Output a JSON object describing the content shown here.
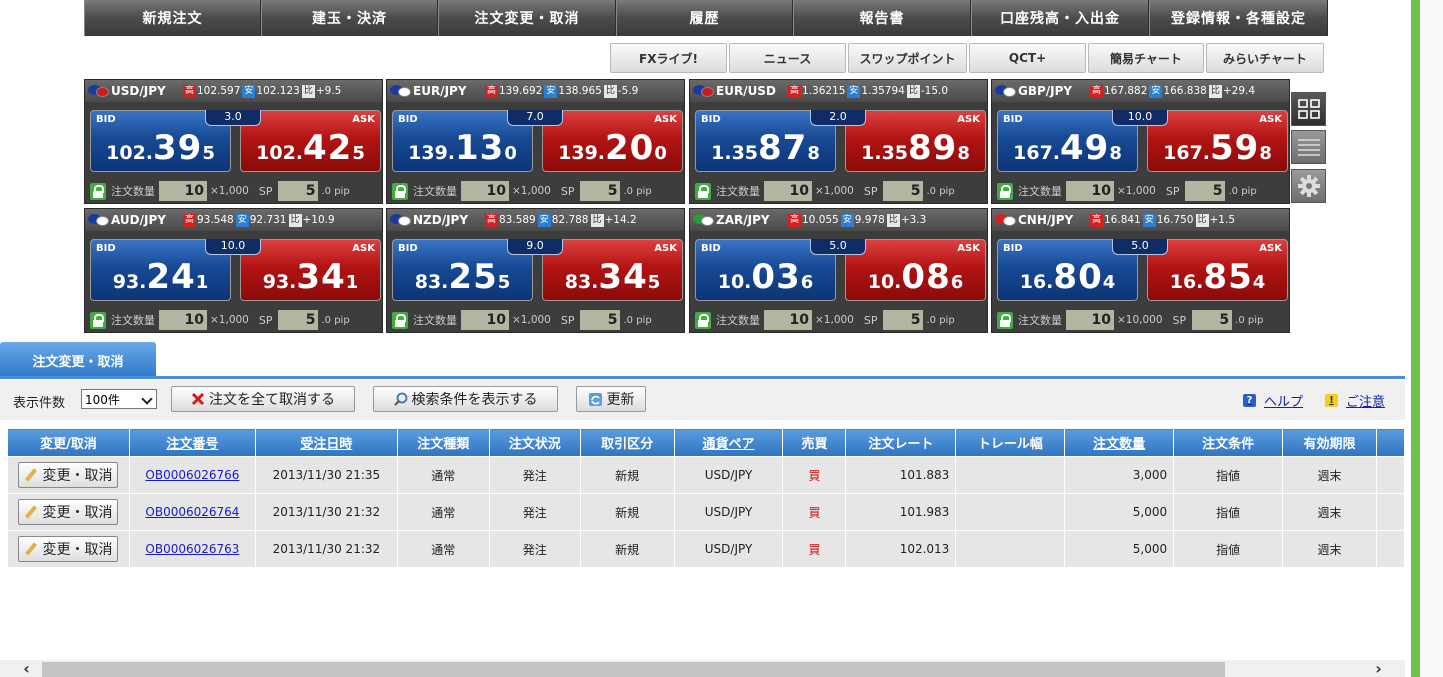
{
  "nav": [
    "新規注文",
    "建玉・決済",
    "注文変更・取消",
    "履歴",
    "報告書",
    "口座残高・入出金",
    "登録情報・各種設定"
  ],
  "subnav": [
    "FXライブ!",
    "ニュース",
    "スワップポイント",
    "QCT+",
    "簡易チャート",
    "みらいチャート"
  ],
  "labels": {
    "high": "高",
    "low": "安",
    "change": "比",
    "bid": "BID",
    "ask": "ASK",
    "qty": "注文数量",
    "sp": "SP",
    "pip": ".0 pip"
  },
  "panels": [
    {
      "pair": "USD/JPY",
      "high": "102.597",
      "low": "102.123",
      "change": "+9.5",
      "spread": "3.0",
      "bid": {
        "s": "102.",
        "b": "39",
        "e": "5"
      },
      "ask": {
        "s": "102.",
        "b": "42",
        "e": "5"
      },
      "qty": "10",
      "unit": "×1,000",
      "sp": "5",
      "f1": "#1a3aa0",
      "f2": "#cc1c1c"
    },
    {
      "pair": "EUR/JPY",
      "high": "139.692",
      "low": "138.965",
      "change": "-5.9",
      "spread": "7.0",
      "bid": {
        "s": "139.",
        "b": "13",
        "e": "0"
      },
      "ask": {
        "s": "139.",
        "b": "20",
        "e": "0"
      },
      "qty": "10",
      "unit": "×1,000",
      "sp": "5",
      "f1": "#1a3aa0",
      "f2": "#ffffff"
    },
    {
      "pair": "EUR/USD",
      "high": "1.36215",
      "low": "1.35794",
      "change": "-15.0",
      "spread": "2.0",
      "bid": {
        "s": "1.35",
        "b": "87",
        "e": "8"
      },
      "ask": {
        "s": "1.35",
        "b": "89",
        "e": "8"
      },
      "qty": "10",
      "unit": "×1,000",
      "sp": "5",
      "f1": "#1a3aa0",
      "f2": "#cc1c1c"
    },
    {
      "pair": "GBP/JPY",
      "high": "167.882",
      "low": "166.838",
      "change": "+29.4",
      "spread": "10.0",
      "bid": {
        "s": "167.",
        "b": "49",
        "e": "8"
      },
      "ask": {
        "s": "167.",
        "b": "59",
        "e": "8"
      },
      "qty": "10",
      "unit": "×1,000",
      "sp": "5",
      "f1": "#1a3aa0",
      "f2": "#ffffff"
    },
    {
      "pair": "AUD/JPY",
      "high": "93.548",
      "low": "92.731",
      "change": "+10.9",
      "spread": "10.0",
      "bid": {
        "s": "93.",
        "b": "24",
        "e": "1"
      },
      "ask": {
        "s": "93.",
        "b": "34",
        "e": "1"
      },
      "qty": "10",
      "unit": "×1,000",
      "sp": "5",
      "f1": "#1a3aa0",
      "f2": "#ffffff"
    },
    {
      "pair": "NZD/JPY",
      "high": "83.589",
      "low": "82.788",
      "change": "+14.2",
      "spread": "9.0",
      "bid": {
        "s": "83.",
        "b": "25",
        "e": "5"
      },
      "ask": {
        "s": "83.",
        "b": "34",
        "e": "5"
      },
      "qty": "10",
      "unit": "×1,000",
      "sp": "5",
      "f1": "#1a3aa0",
      "f2": "#ffffff"
    },
    {
      "pair": "ZAR/JPY",
      "high": "10.055",
      "low": "9.978",
      "change": "+3.3",
      "spread": "5.0",
      "bid": {
        "s": "10.",
        "b": "03",
        "e": "6"
      },
      "ask": {
        "s": "10.",
        "b": "08",
        "e": "6"
      },
      "qty": "10",
      "unit": "×1,000",
      "sp": "5",
      "f1": "#2a9a3a",
      "f2": "#ffffff"
    },
    {
      "pair": "CNH/JPY",
      "high": "16.841",
      "low": "16.750",
      "change": "+1.5",
      "spread": "5.0",
      "bid": {
        "s": "16.",
        "b": "80",
        "e": "4"
      },
      "ask": {
        "s": "16.",
        "b": "85",
        "e": "4"
      },
      "qty": "10",
      "unit": "×10,000",
      "sp": "5",
      "f1": "#d81e1e",
      "f2": "#ffffff"
    }
  ],
  "tab": "注文変更・取消",
  "toolbar": {
    "count_label": "表示件数",
    "count_value": "100件",
    "cancel_all": "注文を全て取消する",
    "show_search": "検索条件を表示する",
    "refresh": "更新",
    "help": "ヘルプ",
    "notice": "ご注意"
  },
  "table": {
    "headers": [
      "変更/取消",
      "注文番号",
      "受注日時",
      "注文種類",
      "注文状況",
      "取引区分",
      "通貨ペア",
      "売買",
      "注文レート",
      "トレール幅",
      "注文数量",
      "注文条件",
      "有効期限"
    ],
    "button": "変更・取消",
    "rows": [
      {
        "id": "OB0006026766",
        "date": "2013/11/30 21:35",
        "type": "通常",
        "status": "発注",
        "kind": "新規",
        "pair": "USD/JPY",
        "side": "買",
        "rate": "101.883",
        "trail": "",
        "qty": "3,000",
        "cond": "指値",
        "exp": "週末"
      },
      {
        "id": "OB0006026764",
        "date": "2013/11/30 21:32",
        "type": "通常",
        "status": "発注",
        "kind": "新規",
        "pair": "USD/JPY",
        "side": "買",
        "rate": "101.983",
        "trail": "",
        "qty": "5,000",
        "cond": "指値",
        "exp": "週末"
      },
      {
        "id": "OB0006026763",
        "date": "2013/11/30 21:32",
        "type": "通常",
        "status": "発注",
        "kind": "新規",
        "pair": "USD/JPY",
        "side": "買",
        "rate": "102.013",
        "trail": "",
        "qty": "5,000",
        "cond": "指値",
        "exp": "週末"
      }
    ]
  },
  "colors": {
    "accent": "#2f73c2",
    "bid": "#174a94",
    "ask": "#b21414",
    "buy": "#d21010",
    "green": "#6cc24a"
  }
}
